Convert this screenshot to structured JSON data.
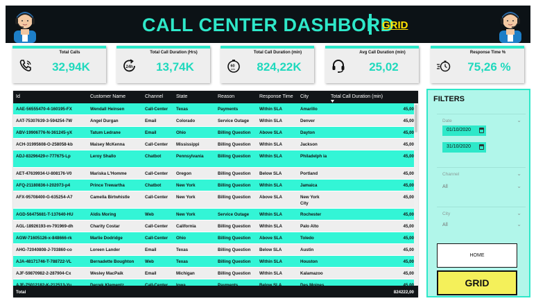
{
  "header": {
    "title": "CALL CENTER DASHBORD",
    "grid_link": "GRID"
  },
  "kpis": [
    {
      "label": "Total Calls",
      "value": "32,94K",
      "icon": "phone-icon"
    },
    {
      "label": "Total Call Duration (Hrs)",
      "value": "13,74K",
      "icon": "24h-clock-icon"
    },
    {
      "label": "Total Call Duration (min)",
      "value": "824,22K",
      "icon": "60-min-timer-icon"
    },
    {
      "label": "Avg Call Duration (min)",
      "value": "25,02",
      "icon": "headset-icon"
    },
    {
      "label": "Response Time %",
      "value": "75,26 %",
      "icon": "stopwatch-icon"
    }
  ],
  "table": {
    "columns": [
      "Id",
      "Customer Name",
      "Channel",
      "State",
      "Reason",
      "Response Time",
      "City",
      "Total Call Duration (min)"
    ],
    "rows": [
      {
        "id": "AAE-56555470-4-160195-FX",
        "customer": "Wendall Heinsen",
        "channel": "Call-Center",
        "state": "Texas",
        "reason": "Payments",
        "response": "Within SLA",
        "city": "Amarillo",
        "duration": "45,00"
      },
      {
        "id": "AAT-75307639-3-594254-7W",
        "customer": "Angel Durgan",
        "channel": "Email",
        "state": "Colorado",
        "reason": "Service Outage",
        "response": "Within SLA",
        "city": "Denver",
        "duration": "45,00"
      },
      {
        "id": "ABV-19906776-N-361245-yX",
        "customer": "Tatum Ledrane",
        "channel": "Email",
        "state": "Ohio",
        "reason": "Billing Question",
        "response": "Above SLA",
        "city": "Dayton",
        "duration": "45,00"
      },
      {
        "id": "ACH-31995608-O-258058-kb",
        "customer": "Maisey McKenna",
        "channel": "Call-Center",
        "state": "Mississippi",
        "reason": "Billing Question",
        "response": "Within SLA",
        "city": "Jackson",
        "duration": "45,00"
      },
      {
        "id": "ADJ-83296429-r-777675-Lp",
        "customer": "Leroy Shallo",
        "channel": "Chatbot",
        "state": "Pennsylvania",
        "reason": "Billing Question",
        "response": "Within SLA",
        "city": "Philadelph ia",
        "duration": "45,00"
      },
      {
        "id": "AET-47639934-U-808176-V0",
        "customer": "Mariska L'Homme",
        "channel": "Call-Center",
        "state": "Oregon",
        "reason": "Billing Question",
        "response": "Below SLA",
        "city": "Portland",
        "duration": "45,00"
      },
      {
        "id": "AFQ-21180836-I-202073-p4",
        "customer": "Prince Trewartha",
        "channel": "Chatbot",
        "state": "New York",
        "reason": "Billing Question",
        "response": "Within SLA",
        "city": "Jamaica",
        "duration": "45,00"
      },
      {
        "id": "AFX-95708400-G-635254-A7",
        "customer": "Camella Birtwhistle",
        "channel": "Call-Center",
        "state": "New York",
        "reason": "Billing Question",
        "response": "Above SLA",
        "city": "New York City",
        "duration": "45,00"
      },
      {
        "id": "AGD-56475681-T-137640-HU",
        "customer": "Aldis Moring",
        "channel": "Web",
        "state": "New York",
        "reason": "Service Outage",
        "response": "Within SLA",
        "city": "Rochester",
        "duration": "45,00"
      },
      {
        "id": "AGL-18926193-m-791969-dh",
        "customer": "Charity Costar",
        "channel": "Call-Center",
        "state": "California",
        "reason": "Billing Question",
        "response": "Within SLA",
        "city": "Palo Alto",
        "duration": "45,00"
      },
      {
        "id": "AGW-71605126-x-848666-rk",
        "customer": "Marlie Dodridge",
        "channel": "Call-Center",
        "state": "Ohio",
        "reason": "Billing Question",
        "response": "Above SLA",
        "city": "Toledo",
        "duration": "45,00"
      },
      {
        "id": "AHG-72040808-J-703860-co",
        "customer": "Loreen Lander",
        "channel": "Email",
        "state": "Texas",
        "reason": "Billing Question",
        "response": "Below SLA",
        "city": "Austin",
        "duration": "45,00"
      },
      {
        "id": "AJA-48171746-T-788722-VL",
        "customer": "Bernadette Boughton",
        "channel": "Web",
        "state": "Texas",
        "reason": "Billing Question",
        "response": "Within SLA",
        "city": "Houston",
        "duration": "45,00"
      },
      {
        "id": "AJF-59870982-2-287904-Cx",
        "customer": "Wesley MacPaik",
        "channel": "Email",
        "state": "Michigan",
        "reason": "Billing Question",
        "response": "Within SLA",
        "city": "Kalamazoo",
        "duration": "45,00"
      },
      {
        "id": "AJF-75012182-K-212513-Yu",
        "customer": "Derrek Klementz",
        "channel": "Call-Center",
        "state": "Iowa",
        "reason": "Payments",
        "response": "Below SLA",
        "city": "Des Moines",
        "duration": "45,00"
      }
    ],
    "total_label": "Total",
    "total_value": "824222,00"
  },
  "filters": {
    "title": "FILTERS",
    "date_label": "Date",
    "date_from": "01/10/2020",
    "date_to": "31/10/2020",
    "channel_label": "Channel",
    "channel_value": "All",
    "city_label": "City",
    "city_value": "All",
    "home_button": "HOME",
    "grid_button": "GRID"
  },
  "colors": {
    "accent": "#2ee8c9",
    "row_highlight": "#33f5d6",
    "header_bg": "#0c1216",
    "grid_button": "#f4f05a"
  }
}
